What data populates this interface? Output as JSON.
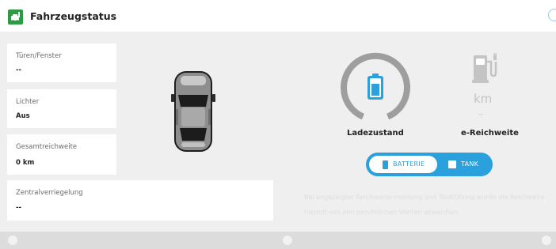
{
  "header": {
    "title": "Fahrzeugstatus",
    "app_icon": "car-status-icon"
  },
  "status_cards": [
    {
      "label": "Türen/Fenster",
      "value": "--"
    },
    {
      "label": "Lichter",
      "value": "Aus"
    },
    {
      "label": "Gesamtreichweite",
      "value": "0 km"
    },
    {
      "label": "Zentralverriegelung",
      "value": "--"
    }
  ],
  "charge": {
    "label": "Ladezustand",
    "icon": "battery-icon",
    "gauge_color": "#9e9e9e",
    "battery_color": "#2aa0dc"
  },
  "range": {
    "label": "e-Reichweite",
    "unit": "km",
    "value": "--",
    "icon": "fuel-pump-icon"
  },
  "mode_toggle": {
    "battery_label": "BATTERIE",
    "tank_label": "TANK",
    "selected": "BATTERIE",
    "accent_color": "#2aa0dc"
  },
  "note": {
    "line1": "Bei angezeigter Reichweitenmeldung und Tankfüllung wurde die Reichweite",
    "line2": "hiermit von den persönlichen Werten abweichen."
  },
  "bottom_bar": {
    "icons": [
      "info-icon",
      "refresh-icon",
      "star-icon"
    ]
  }
}
